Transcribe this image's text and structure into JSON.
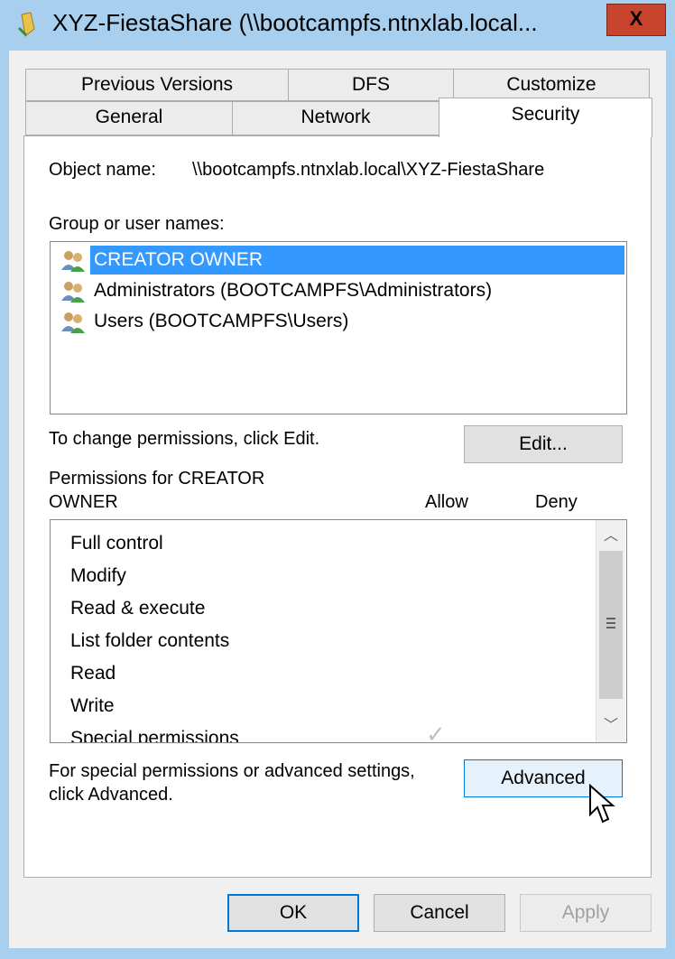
{
  "window": {
    "title": "XYZ-FiestaShare (\\\\bootcampfs.ntnxlab.local...",
    "close_glyph": "X"
  },
  "tabs_row1": [
    "Previous Versions",
    "DFS",
    "Customize"
  ],
  "tabs_row2": [
    "General",
    "Network",
    "Security"
  ],
  "active_tab": "Security",
  "object": {
    "label": "Object name:",
    "value": "\\\\bootcampfs.ntnxlab.local\\XYZ-FiestaShare"
  },
  "groups": {
    "label": "Group or user names:",
    "items": [
      {
        "name": "CREATOR OWNER",
        "selected": true,
        "icon": "users-group-icon"
      },
      {
        "name": "Administrators (BOOTCAMPFS\\Administrators)",
        "selected": false,
        "icon": "users-group-icon"
      },
      {
        "name": "Users (BOOTCAMPFS\\Users)",
        "selected": false,
        "icon": "users-group-icon"
      }
    ]
  },
  "change_hint": "To change permissions, click Edit.",
  "edit_button": "Edit...",
  "permissions": {
    "label_line1": "Permissions for CREATOR",
    "label_line2": "OWNER",
    "allow_label": "Allow",
    "deny_label": "Deny",
    "items": [
      "Full control",
      "Modify",
      "Read & execute",
      "List folder contents",
      "Read",
      "Write",
      "Special permissions"
    ]
  },
  "advanced": {
    "hint_line1": "For special permissions or advanced settings,",
    "hint_line2": "click Advanced.",
    "button": "Advanced"
  },
  "footer": {
    "ok": "OK",
    "cancel": "Cancel",
    "apply": "Apply"
  },
  "colors": {
    "selection": "#3399ff",
    "accent": "#0078d7",
    "close": "#c8442c",
    "frame": "#a9cfee"
  }
}
